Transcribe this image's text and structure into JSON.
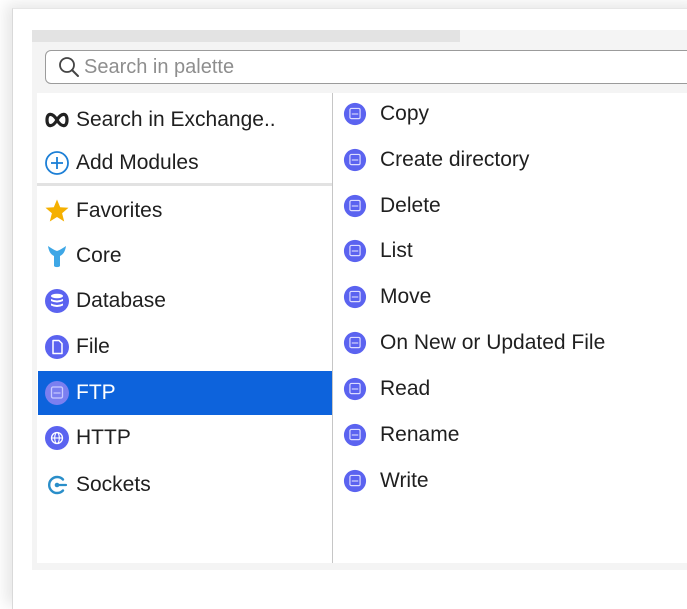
{
  "search": {
    "placeholder": "Search in palette",
    "icon": "search-icon"
  },
  "actions": [
    {
      "label": "Search in Exchange..",
      "icon": "exchange-icon"
    },
    {
      "label": "Add Modules",
      "icon": "add-circle-icon"
    }
  ],
  "modules": [
    {
      "label": "Favorites",
      "icon": "star-icon",
      "color": "#f5b000"
    },
    {
      "label": "Core",
      "icon": "mule-icon",
      "color": "#3ea7e6"
    },
    {
      "label": "Database",
      "icon": "database-icon",
      "color": "#5b63f0"
    },
    {
      "label": "File",
      "icon": "file-icon",
      "color": "#5b63f0"
    },
    {
      "label": "FTP",
      "icon": "ftp-icon",
      "color": "#5b63f0",
      "selected": true
    },
    {
      "label": "HTTP",
      "icon": "globe-icon",
      "color": "#5b63f0"
    },
    {
      "label": "Sockets",
      "icon": "sockets-icon",
      "color": "#2a8ec9"
    }
  ],
  "operations": [
    {
      "label": "Copy"
    },
    {
      "label": "Create directory"
    },
    {
      "label": "Delete"
    },
    {
      "label": "List"
    },
    {
      "label": "Move"
    },
    {
      "label": "On New or Updated File"
    },
    {
      "label": "Read"
    },
    {
      "label": "Rename"
    },
    {
      "label": "Write"
    }
  ],
  "colors": {
    "accent": "#0d63dc",
    "module_icon": "#5b63f0",
    "selected_text": "#ffffff"
  }
}
